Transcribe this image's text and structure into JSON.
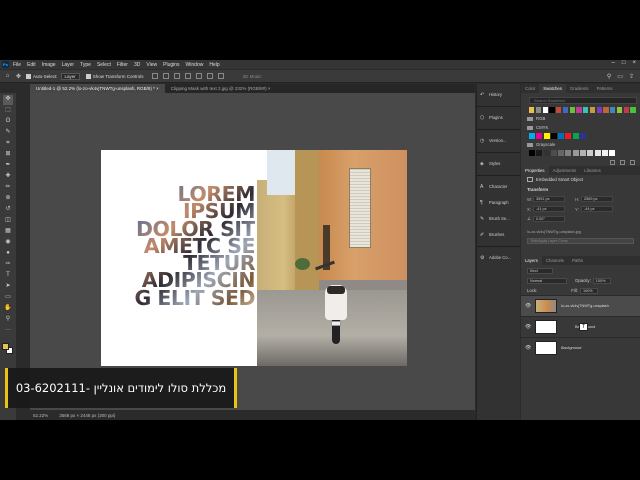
{
  "menu": {
    "logo": "Ps",
    "items": [
      "File",
      "Edit",
      "Image",
      "Layer",
      "Type",
      "Select",
      "Filter",
      "3D",
      "View",
      "Plugins",
      "Window",
      "Help"
    ],
    "window_buttons": [
      "–",
      "□",
      "×"
    ]
  },
  "options": {
    "auto_select_label": "Auto-Select:",
    "auto_select_value": "Layer",
    "show_transform": "Show Transform Controls",
    "mode_3d": "3D Mode:"
  },
  "tabs": [
    {
      "label": "Untitled-1 @ 52.2% (lo-zo-vk4vjTNWTg-unsplash, RGB/8) *  ×",
      "active": true
    },
    {
      "label": "Clipping Mask with text 2.jpg @ 232% (RGB/8#)  ×",
      "active": false
    }
  ],
  "tools": [
    "move-tool",
    "marquee-tool",
    "lasso-tool",
    "quick-select-tool",
    "crop-tool",
    "frame-tool",
    "eyedropper-tool",
    "healing-tool",
    "brush-tool",
    "stamp-tool",
    "history-brush-tool",
    "eraser-tool",
    "gradient-tool",
    "blur-tool",
    "dodge-tool",
    "pen-tool",
    "type-tool",
    "path-select-tool",
    "shape-tool",
    "hand-tool",
    "zoom-tool",
    "more-tools"
  ],
  "tool_glyphs": [
    "✥",
    "⬚",
    "ʘ",
    "✎",
    "⌗",
    "⊠",
    "✒",
    "✚",
    "✏",
    "⊕",
    "↺",
    "◫",
    "▦",
    "◉",
    "●",
    "✑",
    "T",
    "➤",
    "▭",
    "✋",
    "⚲",
    "···"
  ],
  "colors": {
    "foreground": "#e7c14c",
    "background": "#ffffff",
    "accent_yellow": "#e9c317"
  },
  "canvas": {
    "text_lines": [
      "LOREM",
      "IPSUM",
      "DOLOR SIT",
      "AMETC SE",
      "TETUR",
      "ADIPISCIN",
      "G ELIT SED"
    ]
  },
  "status": {
    "zoom": "52.22%",
    "doc_size": "3568 px × 2448 px (300 ppi)"
  },
  "banner": {
    "text": "03-6202111- מכללת סולו לימודים אונליין"
  },
  "mini_panels": [
    {
      "label": "History",
      "icon": "history-icon",
      "glyph": "↶"
    },
    {
      "label": "Plugins",
      "icon": "plugins-icon",
      "glyph": "⬡"
    },
    {
      "label": "Version...",
      "icon": "version-icon",
      "glyph": "◷"
    },
    {
      "label": "Styles",
      "icon": "styles-icon",
      "glyph": "◈"
    },
    {
      "label": "Character",
      "icon": "character-icon",
      "glyph": "A"
    },
    {
      "label": "Paragraph",
      "icon": "paragraph-icon",
      "glyph": "¶"
    },
    {
      "label": "Brush Se...",
      "icon": "brush-settings-icon",
      "glyph": "✎"
    },
    {
      "label": "Brushes",
      "icon": "brushes-icon",
      "glyph": "✐"
    },
    {
      "label": "Adobe Co...",
      "icon": "adobe-color-icon",
      "glyph": "⚙"
    }
  ],
  "swatches_panel": {
    "tabs": [
      "Color",
      "Swatches",
      "Gradients",
      "Patterns"
    ],
    "search_placeholder": "Search Swatches",
    "recent": [
      "#e7c14c",
      "#8a8a8a",
      "#ffffff",
      "#000000",
      "#c14a3a",
      "#3a6ac1",
      "#6ac13a",
      "#c13a9a",
      "#3ac1b8",
      "#c1a03a",
      "#7a3ac1",
      "#c1643a",
      "#3a8ac1",
      "#9ac13a",
      "#c13a4a",
      "#4ac13a"
    ],
    "folders": [
      "RGB",
      "CMYK",
      "Grayscale"
    ],
    "cmyk": [
      "#00aeef",
      "#ec008c",
      "#fff200",
      "#000000",
      "#0072bc",
      "#ed1c24",
      "#00a651",
      "#2e3192"
    ],
    "gray": [
      "#000000",
      "#1a1a1a",
      "#333333",
      "#4d4d4d",
      "#666666",
      "#808080",
      "#999999",
      "#b3b3b3",
      "#cccccc",
      "#e6e6e6",
      "#f2f2f2",
      "#ffffff"
    ]
  },
  "properties_panel": {
    "tabs": [
      "Properties",
      "Adjustments",
      "Libraries"
    ],
    "kind": "Embedded Smart Object",
    "section": "Transform",
    "w": "3591 px",
    "h": "2569 px",
    "x": "-41 px",
    "y": "-44 px",
    "angle": "0.00°",
    "filename": "lo-zo-vk4vjTNWTg-unsplash.jpg",
    "button": "Edit/Apply Layer Comp"
  },
  "layers_panel": {
    "tabs": [
      "Layers",
      "Channels",
      "Paths"
    ],
    "kind": "Kind",
    "blend": "Normal",
    "opacity_label": "Opacity:",
    "opacity": "100%",
    "lock_label": "Lock:",
    "fill_label": "Fill:",
    "fill": "100%",
    "layers": [
      {
        "name": "lo-zo-vk4vjTNWTg-unsplash",
        "selected": true
      },
      {
        "name": "Background",
        "selected": false
      },
      {
        "name": "Background",
        "selected": false
      }
    ]
  }
}
